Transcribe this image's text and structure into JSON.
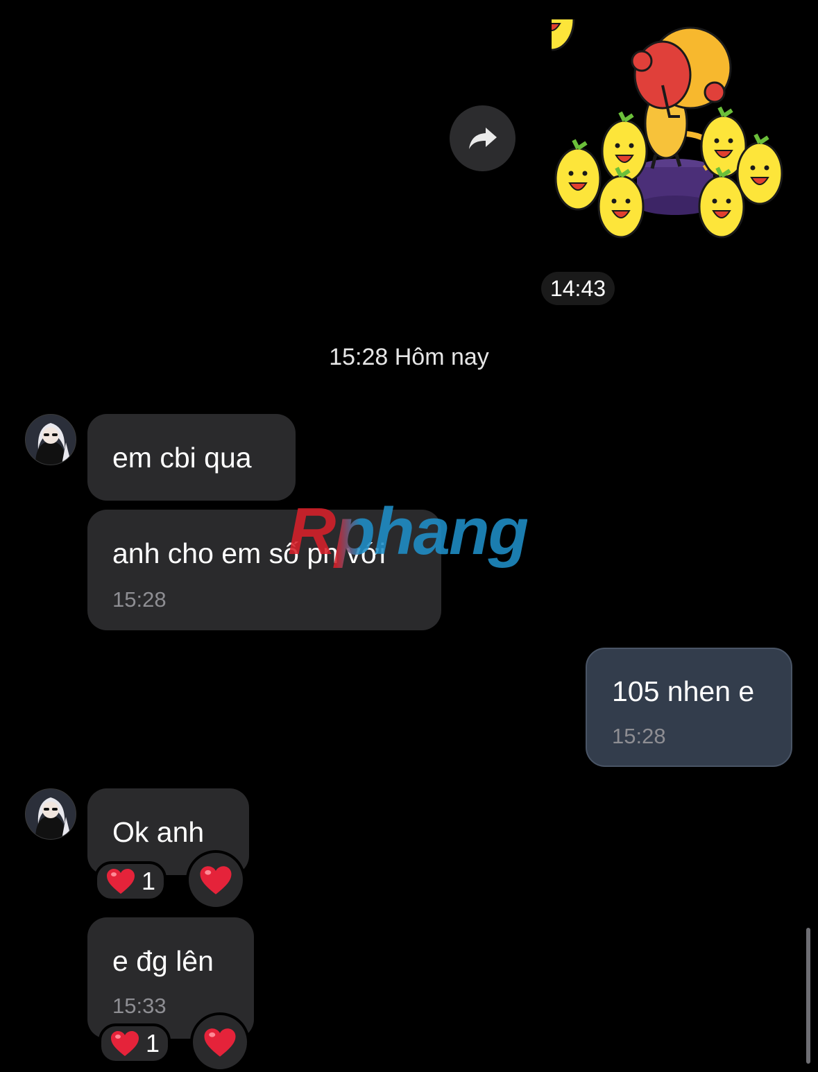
{
  "sticker": {
    "time": "14:43",
    "forward_icon": "forward-arrow-icon"
  },
  "divider": {
    "label": "15:28 Hôm nay"
  },
  "messages": [
    {
      "text": "em cbi qua"
    },
    {
      "text": "anh cho em số pn với",
      "time": "15:28"
    },
    {
      "text": "105 nhen e",
      "time": "15:28"
    },
    {
      "text": "Ok anh",
      "reaction_count": "1"
    },
    {
      "text": "e đg lên",
      "time": "15:33",
      "reaction_count": "1"
    }
  ],
  "watermark": {
    "text": "Rphang"
  },
  "colors": {
    "background": "#000000",
    "incoming_bubble": "#2a2a2c",
    "outgoing_bubble": "#333d4c",
    "heart": "#e5233a"
  }
}
